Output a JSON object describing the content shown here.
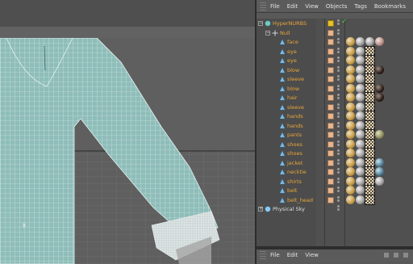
{
  "object_manager": {
    "menu": [
      "File",
      "Edit",
      "View",
      "Objects",
      "Tags",
      "Bookmarks"
    ],
    "objects": [
      {
        "label": "HyperNURBS",
        "depth": 0,
        "expander": "−",
        "icon": "hypernurbs-icon",
        "color": "orange",
        "layer": "yellow",
        "check": "✓",
        "tags": []
      },
      {
        "label": "Null",
        "depth": 1,
        "expander": "−",
        "icon": "null-icon",
        "color": "orange",
        "layer": "skin",
        "check": "",
        "tags": []
      },
      {
        "label": "face",
        "depth": 2,
        "icon": "polygon-icon",
        "color": "orange",
        "layer": "skin",
        "tags": [
          "phong",
          "mat-grey",
          "mat-grey",
          "mat-skin"
        ]
      },
      {
        "label": "eye",
        "depth": 2,
        "icon": "polygon-icon",
        "color": "orange",
        "layer": "skin",
        "tags": [
          "phong",
          "mat-grey",
          "uvw"
        ]
      },
      {
        "label": "eye",
        "depth": 2,
        "icon": "polygon-icon",
        "color": "orange",
        "layer": "skin",
        "tags": [
          "phong",
          "mat-grey",
          "uvw"
        ]
      },
      {
        "label": "blow",
        "depth": 2,
        "icon": "polygon-icon",
        "color": "orange",
        "layer": "skin",
        "tags": [
          "phong",
          "mat-grey",
          "uvw",
          "mat-dark"
        ]
      },
      {
        "label": "sleeve",
        "depth": 2,
        "icon": "polygon-icon",
        "color": "orange",
        "layer": "skin",
        "tags": [
          "phong",
          "mat-grey",
          "uvw"
        ]
      },
      {
        "label": "blow",
        "depth": 2,
        "icon": "polygon-icon",
        "color": "orange",
        "layer": "skin",
        "tags": [
          "phong",
          "mat-grey",
          "uvw",
          "mat-dark"
        ]
      },
      {
        "label": "hair",
        "depth": 2,
        "icon": "polygon-icon",
        "color": "orange",
        "layer": "skin",
        "tags": [
          "phong",
          "mat-grey",
          "uvw",
          "mat-dark"
        ]
      },
      {
        "label": "sleeve",
        "depth": 2,
        "icon": "polygon-icon",
        "color": "orange",
        "layer": "skin",
        "tags": [
          "phong",
          "mat-grey",
          "uvw"
        ]
      },
      {
        "label": "hands",
        "depth": 2,
        "icon": "polygon-icon",
        "color": "orange",
        "layer": "skin",
        "tags": [
          "phong",
          "mat-grey",
          "uvw"
        ]
      },
      {
        "label": "hands",
        "depth": 2,
        "icon": "polygon-icon",
        "color": "orange",
        "layer": "skin",
        "tags": [
          "phong",
          "mat-grey",
          "uvw"
        ]
      },
      {
        "label": "pants",
        "depth": 2,
        "icon": "polygon-icon",
        "color": "orange",
        "layer": "skin",
        "tags": [
          "phong",
          "mat-grey",
          "uvw",
          "mat-olive"
        ]
      },
      {
        "label": "shoes",
        "depth": 2,
        "icon": "polygon-icon",
        "color": "orange",
        "layer": "skin",
        "tags": [
          "phong",
          "mat-grey",
          "uvw"
        ]
      },
      {
        "label": "shoes",
        "depth": 2,
        "icon": "polygon-icon",
        "color": "orange",
        "layer": "skin",
        "tags": [
          "phong",
          "mat-grey",
          "uvw"
        ]
      },
      {
        "label": "jacket",
        "depth": 2,
        "icon": "polygon-icon",
        "color": "orange",
        "layer": "skin",
        "tags": [
          "phong",
          "mat-grey",
          "uvw",
          "mat-blue"
        ]
      },
      {
        "label": "necktie",
        "depth": 2,
        "icon": "polygon-icon",
        "color": "orange",
        "layer": "skin",
        "tags": [
          "phong",
          "mat-grey",
          "uvw",
          "mat-blue"
        ]
      },
      {
        "label": "shirts",
        "depth": 2,
        "icon": "polygon-icon",
        "color": "orange",
        "layer": "skin",
        "tags": [
          "phong",
          "mat-grey",
          "uvw",
          "mat-grey"
        ]
      },
      {
        "label": "belt",
        "depth": 2,
        "icon": "polygon-icon",
        "color": "orange",
        "layer": "skin",
        "tags": [
          "phong",
          "mat-grey",
          "uvw"
        ]
      },
      {
        "label": "belt_head",
        "depth": 2,
        "icon": "polygon-icon",
        "color": "orange",
        "layer": "skin",
        "tags": [
          "phong",
          "mat-grey",
          "uvw"
        ]
      },
      {
        "label": "Physical Sky",
        "depth": 0,
        "expander": "+",
        "icon": "sky-icon",
        "color": "white",
        "layer": "none",
        "tags": []
      }
    ]
  },
  "attribute_manager": {
    "menu": [
      "File",
      "Edit",
      "View"
    ]
  },
  "viewport": {
    "nav_icons": [
      "move-icon",
      "zoom-icon",
      "rotate-icon",
      "maximize-icon"
    ],
    "nav_glyphs": [
      "✥",
      "↓",
      "⟳",
      "◫"
    ]
  }
}
